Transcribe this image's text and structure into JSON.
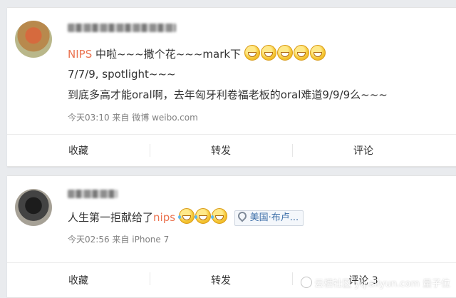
{
  "post1": {
    "mention": "NIPS",
    "text1": " 中啦~~~撒个花~~~mark下",
    "emojis": [
      "grin-emoji",
      "grin-emoji",
      "shock-emoji",
      "grin-emoji",
      "smile-emoji"
    ],
    "line2": "7/7/9, spotlight~~~",
    "line3": "到底多高才能oral啊，去年匈牙利卷福老板的oral难道9/9/9么~~~",
    "time": "今天03:10",
    "from_label": "来自",
    "source": "微博 weibo.com"
  },
  "post2": {
    "text": "人生第一拒献给了",
    "mention": "nips",
    "emojis": [
      "laugh-tears-emoji",
      "laugh-tears-emoji",
      "laugh-tears-emoji"
    ],
    "location": "美国·布卢...",
    "time": "今天02:56",
    "from_label": "来自",
    "source": "iPhone 7"
  },
  "actions": {
    "favorite": "收藏",
    "repost": "转发",
    "comment": "评论",
    "comment_count": "评论 3"
  },
  "watermark": "云栖社区 yq.aliyun.com  量子位"
}
